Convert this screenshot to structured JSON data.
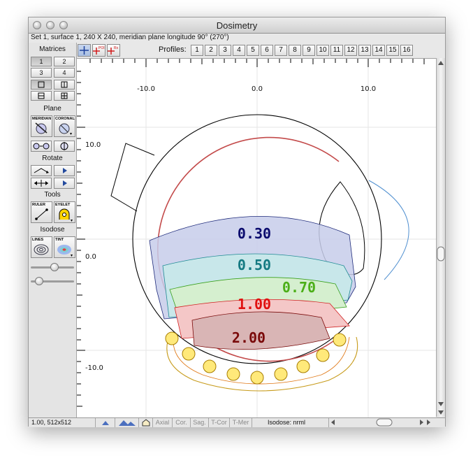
{
  "window": {
    "title": "Dosimetry"
  },
  "info": {
    "text": "Set 1, surface 1, 240 X 240, meridian plane longitude 90° (270°)"
  },
  "left_panel": {
    "matrices_label": "Matrices",
    "matrix_buttons": [
      "1",
      "2",
      "3",
      "4"
    ],
    "plane_label": "Plane",
    "meridian_label": "MERIDIAN",
    "coronal_label": "CORONAL",
    "rotate_label": "Rotate",
    "tools_label": "Tools",
    "ruler_label": "RULER",
    "eyelet_label": "EYELET",
    "isodose_label": "Isodose",
    "lines_label": "LINES",
    "tint_label": "TINT",
    "slider1_level": 0.55,
    "slider2_level": 0.12
  },
  "toolbar": {
    "profiles_label": "Profiles:",
    "profile_buttons": [
      "1",
      "2",
      "3",
      "4",
      "5",
      "6",
      "7",
      "8",
      "9",
      "10",
      "11",
      "12",
      "13",
      "14",
      "15",
      "16"
    ],
    "tool_icons": [
      "crosshair-icon",
      "point-poi-icon",
      "point-rx-icon"
    ],
    "poi_text": "POI",
    "rx_text": "Rx"
  },
  "plot": {
    "x_ticks": [
      "-10.0",
      "0.0",
      "10.0"
    ],
    "y_ticks": [
      "10.0",
      "0.0",
      "-10.0"
    ],
    "isodose_labels": [
      {
        "text": "0.30",
        "color": "#0b0b6e"
      },
      {
        "text": "0.50",
        "color": "#157a82"
      },
      {
        "text": "0.70",
        "color": "#4caf18"
      },
      {
        "text": "1.00",
        "color": "#e01010"
      },
      {
        "text": "2.00",
        "color": "#7a0a0a"
      }
    ]
  },
  "statusbar": {
    "coords": "1.00, 512x512",
    "views": [
      "Axial",
      "Cor.",
      "Sag.",
      "T-Cor",
      "T-Mer"
    ],
    "isodose_mode": "Isodose: nrml"
  },
  "colors": {
    "iso_030_fill": "#c7cdea",
    "iso_050_fill": "#c8e7ea",
    "iso_070_fill": "#d5efcf",
    "iso_100_fill": "#f4c7c7",
    "iso_200_fill": "#d9b5b5",
    "globe": "#000000",
    "inner_globe": "#c44444",
    "cornea": "#4f8fd0",
    "seeds": "#ffd400"
  }
}
